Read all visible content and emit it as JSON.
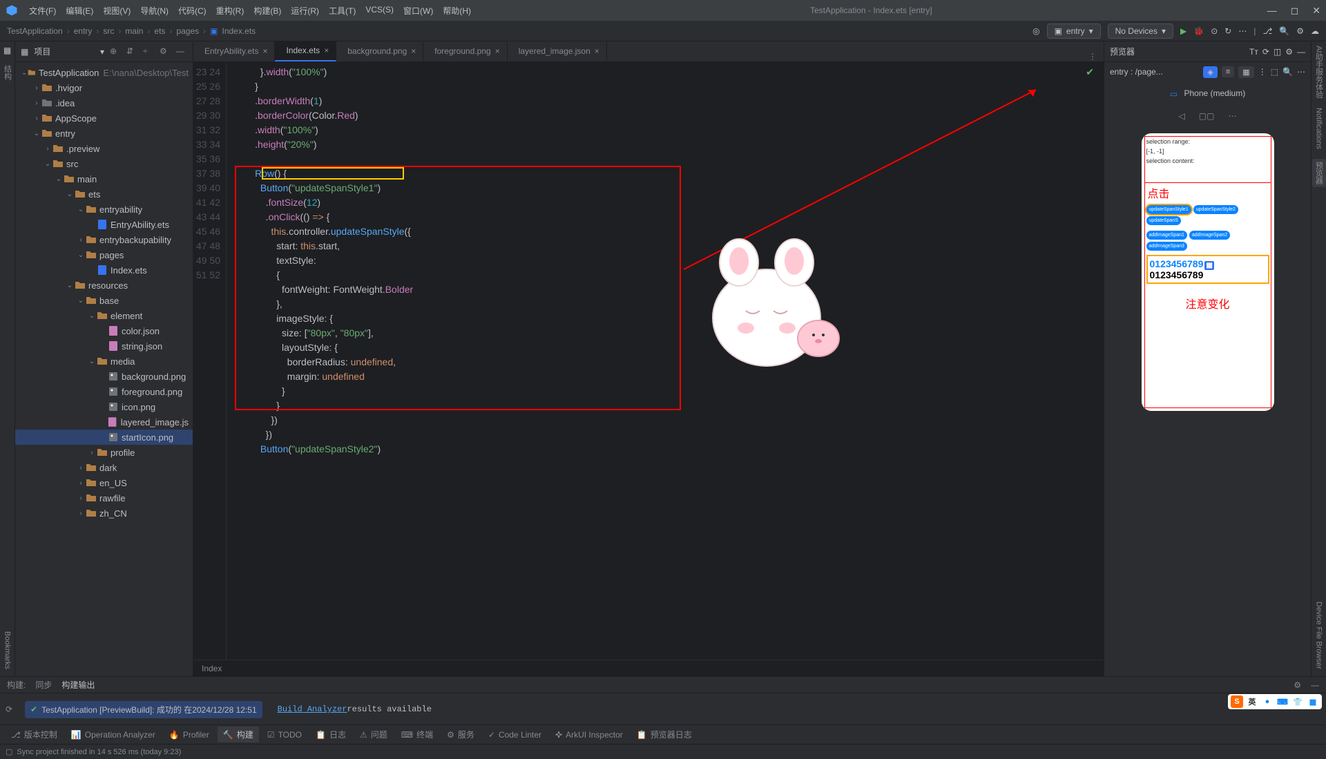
{
  "window_title": "TestApplication - Index.ets [entry]",
  "menus": [
    "文件(F)",
    "编辑(E)",
    "视图(V)",
    "导航(N)",
    "代码(C)",
    "重构(R)",
    "构建(B)",
    "运行(R)",
    "工具(T)",
    "VCS(S)",
    "窗口(W)",
    "帮助(H)"
  ],
  "breadcrumb": [
    "TestApplication",
    "entry",
    "src",
    "main",
    "ets",
    "pages",
    "Index.ets"
  ],
  "run_config": "entry",
  "devices": "No Devices",
  "project_label": "项目",
  "tree": [
    {
      "d": 0,
      "a": "v",
      "ic": "fy",
      "t": "TestApplication",
      "h": "E:\\nana\\Desktop\\Test"
    },
    {
      "d": 1,
      "a": ">",
      "ic": "fy",
      "t": ".hvigor"
    },
    {
      "d": 1,
      "a": ">",
      "ic": "fg",
      "t": ".idea"
    },
    {
      "d": 1,
      "a": ">",
      "ic": "fy",
      "t": "AppScope"
    },
    {
      "d": 1,
      "a": "v",
      "ic": "fy",
      "t": "entry"
    },
    {
      "d": 2,
      "a": ">",
      "ic": "fy",
      "t": ".preview"
    },
    {
      "d": 2,
      "a": "v",
      "ic": "fy",
      "t": "src"
    },
    {
      "d": 3,
      "a": "v",
      "ic": "fy",
      "t": "main"
    },
    {
      "d": 4,
      "a": "v",
      "ic": "fy",
      "t": "ets"
    },
    {
      "d": 5,
      "a": "v",
      "ic": "fy",
      "t": "entryability"
    },
    {
      "d": 6,
      "a": "",
      "ic": "fe",
      "t": "EntryAbility.ets"
    },
    {
      "d": 5,
      "a": ">",
      "ic": "fy",
      "t": "entrybackupability"
    },
    {
      "d": 5,
      "a": "v",
      "ic": "fy",
      "t": "pages"
    },
    {
      "d": 6,
      "a": "",
      "ic": "fe",
      "t": "Index.ets"
    },
    {
      "d": 4,
      "a": "v",
      "ic": "fy",
      "t": "resources"
    },
    {
      "d": 5,
      "a": "v",
      "ic": "fy",
      "t": "base"
    },
    {
      "d": 6,
      "a": "v",
      "ic": "fy",
      "t": "element"
    },
    {
      "d": 7,
      "a": "",
      "ic": "fj",
      "t": "color.json"
    },
    {
      "d": 7,
      "a": "",
      "ic": "fj",
      "t": "string.json"
    },
    {
      "d": 6,
      "a": "v",
      "ic": "fy",
      "t": "media"
    },
    {
      "d": 7,
      "a": "",
      "ic": "fi",
      "t": "background.png"
    },
    {
      "d": 7,
      "a": "",
      "ic": "fi",
      "t": "foreground.png"
    },
    {
      "d": 7,
      "a": "",
      "ic": "fi",
      "t": "icon.png"
    },
    {
      "d": 7,
      "a": "",
      "ic": "fj",
      "t": "layered_image.js"
    },
    {
      "d": 7,
      "a": "",
      "ic": "fi",
      "t": "startIcon.png",
      "sel": true
    },
    {
      "d": 6,
      "a": ">",
      "ic": "fy",
      "t": "profile"
    },
    {
      "d": 5,
      "a": ">",
      "ic": "fy",
      "t": "dark"
    },
    {
      "d": 5,
      "a": ">",
      "ic": "fy",
      "t": "en_US"
    },
    {
      "d": 5,
      "a": ">",
      "ic": "fy",
      "t": "rawfile"
    },
    {
      "d": 5,
      "a": ">",
      "ic": "fy",
      "t": "zh_CN"
    }
  ],
  "tabs": [
    {
      "t": "EntryAbility.ets",
      "ic": "fe"
    },
    {
      "t": "Index.ets",
      "ic": "fe",
      "active": true
    },
    {
      "t": "background.png",
      "ic": "fi"
    },
    {
      "t": "foreground.png",
      "ic": "fi"
    },
    {
      "t": "layered_image.json",
      "ic": "fj"
    }
  ],
  "line_start": 23,
  "line_end": 52,
  "editor_crumb": "Index",
  "preview_title": "预览器",
  "preview_path": "entry : /page...",
  "device_label": "Phone (medium)",
  "phone": {
    "sel_range": "selection range:",
    "sel_val": "[-1, -1]",
    "sel_content": "selection content:",
    "anno1": "点击",
    "row1": [
      "updateSpanStyle1",
      "updateSpanStyle2",
      "updateSpanS"
    ],
    "row2": [
      "addImageSpan1",
      "addImageSpan2",
      "addImageSpan3"
    ],
    "data1": "0123456789",
    "data2": "0123456789",
    "anno2": "注意变化"
  },
  "build_tabs": {
    "l1": "构建:",
    "l2": "同步",
    "l3": "构建输出"
  },
  "build_status": "TestApplication [PreviewBuild]: 成功的 在2024/12/28 12:51",
  "build_link": "Build Analyzer",
  "build_rest": " results available",
  "bottom_items": [
    "版本控制",
    "Operation Analyzer",
    "Profiler",
    "构建",
    "TODO",
    "日志",
    "问题",
    "终端",
    "服务",
    "Code Linter",
    "ArkUI Inspector",
    "预览器日志"
  ],
  "bottom_active": 3,
  "status_text": "Sync project finished in 14 s 526 ms (today 9:23)",
  "left_tabs": [
    "结构",
    "Bookmarks"
  ],
  "right_tabs": [
    "AI助手服务体验",
    "Notifications",
    "预览器",
    "Device File Browser"
  ],
  "right_active": 2,
  "ime_labels": [
    "英",
    "●",
    "▦",
    "👕",
    "⬛"
  ]
}
